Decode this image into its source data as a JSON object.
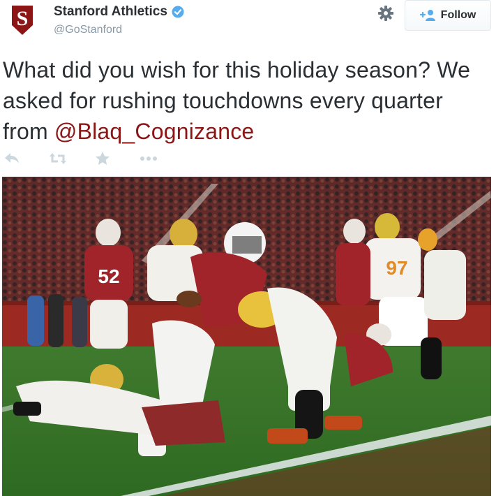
{
  "author": {
    "name": "Stanford Athletics",
    "handle": "@GoStanford",
    "logo_letter": "S",
    "verified": true
  },
  "header": {
    "follow_label": "Follow",
    "gear_icon": "gear-icon",
    "follow_icon": "add-user-icon"
  },
  "tweet": {
    "text_before": "What did you wish for this holiday season? We asked for rushing touchdowns every quarter from ",
    "mention": "@Blaq_Cognizance"
  },
  "actions": [
    {
      "icon": "reply-icon"
    },
    {
      "icon": "retweet-icon"
    },
    {
      "icon": "favorite-star-icon"
    },
    {
      "icon": "more-dots-icon"
    }
  ],
  "photo": {
    "jersey_left": "52",
    "jersey_right": "97"
  },
  "colors": {
    "brand": "#8c1515",
    "verified": "#55acee",
    "icon_gray": "#ccd6dd",
    "handle_gray": "#8899a6"
  }
}
